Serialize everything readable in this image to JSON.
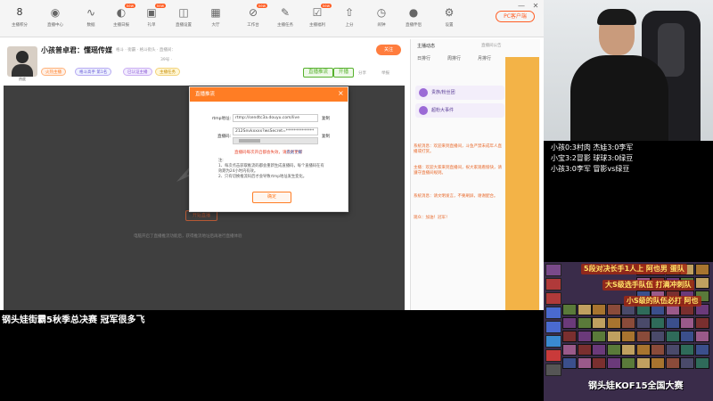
{
  "topnav": {
    "items": [
      {
        "label": "主播积分",
        "icon": "8"
      },
      {
        "label": "直播中心",
        "icon": "camera-icon"
      },
      {
        "label": "数据",
        "icon": "pulse-icon"
      },
      {
        "label": "主播日报",
        "icon": "chart-icon",
        "badge": "new"
      },
      {
        "label": "礼单",
        "icon": "gift-icon",
        "badge": "new"
      },
      {
        "label": "直播设置",
        "icon": "tv-icon"
      },
      {
        "label": "大厅",
        "icon": "grid-icon"
      },
      {
        "label": "工作台",
        "icon": "tool-icon",
        "badge": "new"
      },
      {
        "label": "主播任务",
        "icon": "task-icon"
      },
      {
        "label": "主播福利",
        "icon": "gift2-icon",
        "badge": "new"
      },
      {
        "label": "上分",
        "icon": "upload-icon"
      },
      {
        "label": "闹钟",
        "icon": "clock-icon"
      },
      {
        "label": "直播伴侣",
        "icon": "mic-icon"
      },
      {
        "label": "设置",
        "icon": "gear-icon"
      }
    ],
    "pc_button": "PC客户端",
    "window_min": "—",
    "window_close": "✕"
  },
  "streamer": {
    "room_title": "小孩普卓君：懂瑶传媒",
    "meta_line1": "格斗 · 街霸 · 格斗街头 · 直播间：",
    "meta_line2": "39号 ·",
    "avatar_label": "热度",
    "follow": "关注",
    "tags": [
      "火热主播",
      "格斗高手 第1名",
      "已认证主播",
      "主播任务"
    ],
    "live_buttons": [
      "直播推流",
      "开播"
    ],
    "share": "分享",
    "report": "举报"
  },
  "player": {
    "start_button": "开始直播",
    "hint": "电脑开启了直播推流功能后，获得推流地址后再进行直播体验"
  },
  "modal": {
    "title": "直播推流",
    "close": "×",
    "rtmp_label": "rtmp地址:",
    "rtmp_value": "rtmp://sendtc3a.douyu.com/live",
    "stream_label": "直播码:",
    "stream_value": "212Snvkxxxx?wsSecret=**************",
    "copy": "复制",
    "warning_link": "直播码每次开启都会失效，请及时更新",
    "help_link": "点此了解",
    "notes_title": "注:",
    "note1": "1、每次点击获取推流码都会重新生成直播码，每个直播码在有效期为24小时内有效。",
    "note2": "2、只有切换推流码后才会导致rtmp地址发生变化。",
    "ok_button": "确定"
  },
  "sidebar": {
    "header": "主播动态",
    "sub": "直播间公告",
    "tabs": [
      "日排行",
      "周排行",
      "月排行"
    ],
    "item1": "贵族/粉丝团",
    "item2": "超粉大事件",
    "chat": [
      "系统消息：欢迎来到直播间，斗鱼严禁未成年人直播或打赏。",
      "主播：欢迎大家来到直播间，祝大家观看愉快，请遵守直播间规则。",
      "系统消息：请文明发言，不要刷屏，谢谢配合。",
      "观众：加油！冠军！"
    ]
  },
  "scores": [
    "小孩0:3村肉  杰娃3:0李军",
    "小宝3:2冒影  球球3:0绿豆",
    "小孩3:0李军  冒影vs绿豆"
  ],
  "event_title": "钢头娃街霸5秋季总决赛  冠军很多飞",
  "team_banners": [
    "5段对决长手1人上 阿也男 蛋队",
    "大S级选手队伍 打满冲刺队",
    "小S级的队伍必打 阿也"
  ],
  "kof_title": "钢头娃KOF15全国大赛",
  "colors": {
    "accent": "#ff5d23",
    "modal_header": "#ff7d24",
    "green": "#56b12c"
  }
}
